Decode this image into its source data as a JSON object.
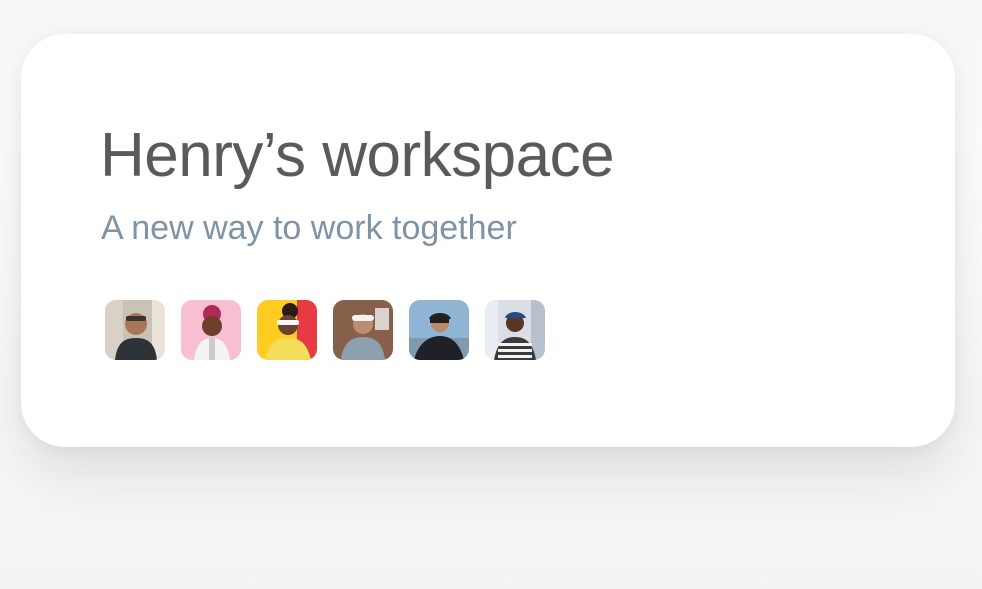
{
  "workspace": {
    "title": "Henry’s workspace",
    "subtitle": "A new way to work together"
  },
  "colors": {
    "title": "#5a5a5a",
    "subtitle": "#7e93a3",
    "card_background": "#ffffff"
  },
  "members": [
    {
      "icon": "member-photo-1",
      "background": "#c9c2b6",
      "skin": "#a77656",
      "shirt": "#2d3338"
    },
    {
      "icon": "member-photo-2",
      "background": "#f7bfd0",
      "skin": "#6a3f2c",
      "shirt": "#f3f3f3"
    },
    {
      "icon": "member-photo-3",
      "background": "#ffcc22",
      "skin": "#6b4230",
      "shirt": "#f5dd59"
    },
    {
      "icon": "member-photo-4",
      "background": "#86604a",
      "skin": "#bb8e73",
      "shirt": "#8ca0b0"
    },
    {
      "icon": "member-photo-5",
      "background": "#8fb4d4",
      "skin": "#bd8866",
      "shirt": "#1e2227"
    },
    {
      "icon": "member-photo-6",
      "background": "#d9dfe5",
      "skin": "#593627",
      "shirt": "#3a3a3a"
    }
  ]
}
